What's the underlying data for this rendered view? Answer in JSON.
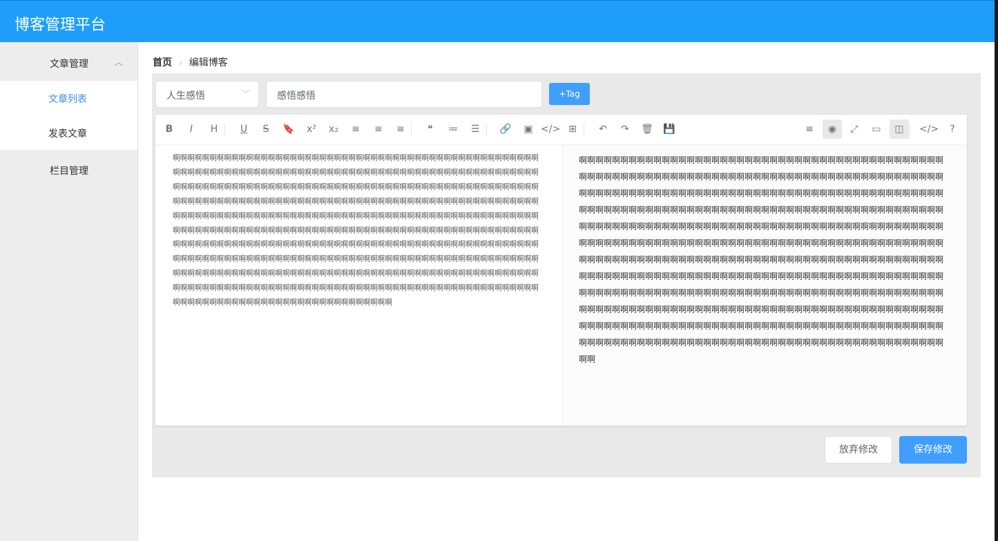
{
  "app": {
    "title": "博客管理平台"
  },
  "sidebar": {
    "group_article": {
      "label": "文章管理",
      "chevron": "chevron-up-icon"
    },
    "items": [
      {
        "label": "文章列表",
        "active": true
      },
      {
        "label": "发表文章",
        "active": false
      }
    ],
    "group_column": {
      "label": "栏目管理"
    }
  },
  "breadcrumb": {
    "home": "首页",
    "current": "编辑博客"
  },
  "form": {
    "category": "人生感悟",
    "title": "感悟感悟",
    "tag_button": "+Tag"
  },
  "editor": {
    "toolbar_left": [
      {
        "icon": "bold-icon",
        "glyph": "B"
      },
      {
        "icon": "italic-icon",
        "glyph": "I"
      },
      {
        "icon": "heading-icon",
        "glyph": "H"
      },
      {
        "icon": "underline-icon",
        "glyph": "U"
      },
      {
        "icon": "strikethrough-icon",
        "glyph": "S"
      },
      {
        "icon": "bookmark-icon",
        "glyph": "🔖"
      },
      {
        "icon": "superscript-icon",
        "glyph": "x²"
      },
      {
        "icon": "subscript-icon",
        "glyph": "x₂"
      },
      {
        "icon": "align-left-icon",
        "glyph": "≡"
      },
      {
        "icon": "align-center-icon",
        "glyph": "≡"
      },
      {
        "icon": "align-right-icon",
        "glyph": "≡"
      },
      {
        "icon": "quote-icon",
        "glyph": "❝"
      },
      {
        "icon": "ordered-list-icon",
        "glyph": "≔"
      },
      {
        "icon": "unordered-list-icon",
        "glyph": "☰"
      },
      {
        "icon": "link-icon",
        "glyph": "🔗"
      },
      {
        "icon": "image-icon",
        "glyph": "▣"
      },
      {
        "icon": "code-icon",
        "glyph": "</>"
      },
      {
        "icon": "table-icon",
        "glyph": "⊞"
      },
      {
        "icon": "undo-icon",
        "glyph": "↶"
      },
      {
        "icon": "redo-icon",
        "glyph": "↷"
      },
      {
        "icon": "trash-icon",
        "glyph": "🗑"
      },
      {
        "icon": "save-icon",
        "glyph": "💾"
      }
    ],
    "toolbar_right": [
      {
        "icon": "navigation-icon",
        "glyph": "≡"
      },
      {
        "icon": "preview-toggle-icon",
        "glyph": "◉"
      },
      {
        "icon": "fullscreen-icon",
        "glyph": "⤢"
      },
      {
        "icon": "window-icon",
        "glyph": "▭"
      },
      {
        "icon": "split-view-icon",
        "glyph": "◫"
      },
      {
        "icon": "source-code-icon",
        "glyph": "</>"
      },
      {
        "icon": "help-icon",
        "glyph": "?"
      }
    ],
    "content": "啊啊啊啊啊啊啊啊啊啊啊啊啊啊啊啊啊啊啊啊啊啊啊啊啊啊啊啊啊啊啊啊啊啊啊啊啊啊啊啊啊啊啊啊啊啊啊啊啊啊啊啊啊啊啊啊啊啊啊啊啊啊啊啊啊啊啊啊啊啊啊啊啊啊啊啊啊啊啊啊啊啊啊啊啊啊啊啊啊啊啊啊啊啊啊啊啊啊啊啊啊啊啊啊啊啊啊啊啊啊啊啊啊啊啊啊啊啊啊啊啊啊啊啊啊啊啊啊啊啊啊啊啊啊啊啊啊啊啊啊啊啊啊啊啊啊啊啊啊啊啊啊啊啊啊啊啊啊啊啊啊啊啊啊啊啊啊啊啊啊啊啊啊啊啊啊啊啊啊啊啊啊啊啊啊啊啊啊啊啊啊啊啊啊啊啊啊啊啊啊啊啊啊啊啊啊啊啊啊啊啊啊啊啊啊啊啊啊啊啊啊啊啊啊啊啊啊啊啊啊啊啊啊啊啊啊啊啊啊啊啊啊啊啊啊啊啊啊啊啊啊啊啊啊啊啊啊啊啊啊啊啊啊啊啊啊啊啊啊啊啊啊啊啊啊啊啊啊啊啊啊啊啊啊啊啊啊啊啊啊啊啊啊啊啊啊啊啊啊啊啊啊啊啊啊啊啊啊啊啊啊啊啊啊啊啊啊啊啊啊啊啊啊啊啊啊啊啊啊啊啊啊啊啊啊啊啊啊啊啊啊啊啊啊啊啊啊啊啊啊啊啊啊啊啊啊啊啊啊啊啊啊啊啊啊啊啊啊啊啊啊啊啊啊啊啊啊啊啊啊啊啊啊啊啊啊啊啊啊啊啊啊啊啊啊啊啊啊啊啊啊啊啊啊啊啊啊啊啊啊啊啊啊啊啊啊啊啊啊啊啊啊啊啊啊啊啊啊啊啊啊啊啊啊啊啊啊啊啊啊啊啊啊啊啊啊啊啊啊啊啊啊啊啊啊啊啊啊啊啊啊啊啊啊啊啊啊啊啊啊啊啊啊啊啊啊啊啊啊啊啊啊啊啊啊啊啊啊啊啊啊啊啊啊啊啊啊啊啊啊啊啊啊啊啊啊啊啊啊啊啊啊啊啊啊啊啊啊啊啊啊啊啊啊啊啊啊啊啊啊"
  },
  "actions": {
    "cancel": "放弃修改",
    "save": "保存修改"
  },
  "colors": {
    "header": "#1e9ef9",
    "primary": "#409eff",
    "active_menu": "#3a8ee6"
  }
}
